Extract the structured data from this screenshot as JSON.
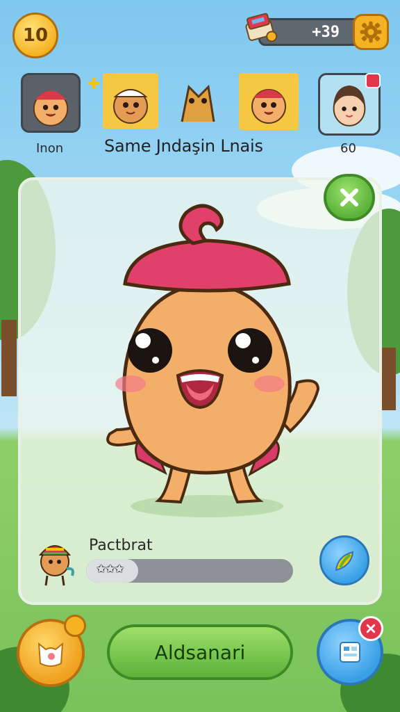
{
  "hud": {
    "level": "10",
    "coins": "+39"
  },
  "characters": [
    {
      "label": "Inon"
    },
    {
      "label": ""
    },
    {
      "label": ""
    },
    {
      "label": ""
    },
    {
      "label": "60"
    }
  ],
  "title": "Same Jndaşin Lnais",
  "selected": {
    "name": "Pactbrat",
    "progress": 0.25,
    "stars": "✩✩✩"
  },
  "buttons": {
    "main": "Aldsanari"
  },
  "colors": {
    "accent_green": "#5cb23b",
    "accent_orange": "#f5b323",
    "hat_pink": "#e0406a",
    "body_peach": "#f3ae6a",
    "alert_red": "#e2374b"
  },
  "icons": [
    "settings-gear-icon",
    "coin-pack-icon",
    "close-x-icon",
    "leaf-edit-icon",
    "cat-face-icon",
    "menu-card-icon"
  ]
}
